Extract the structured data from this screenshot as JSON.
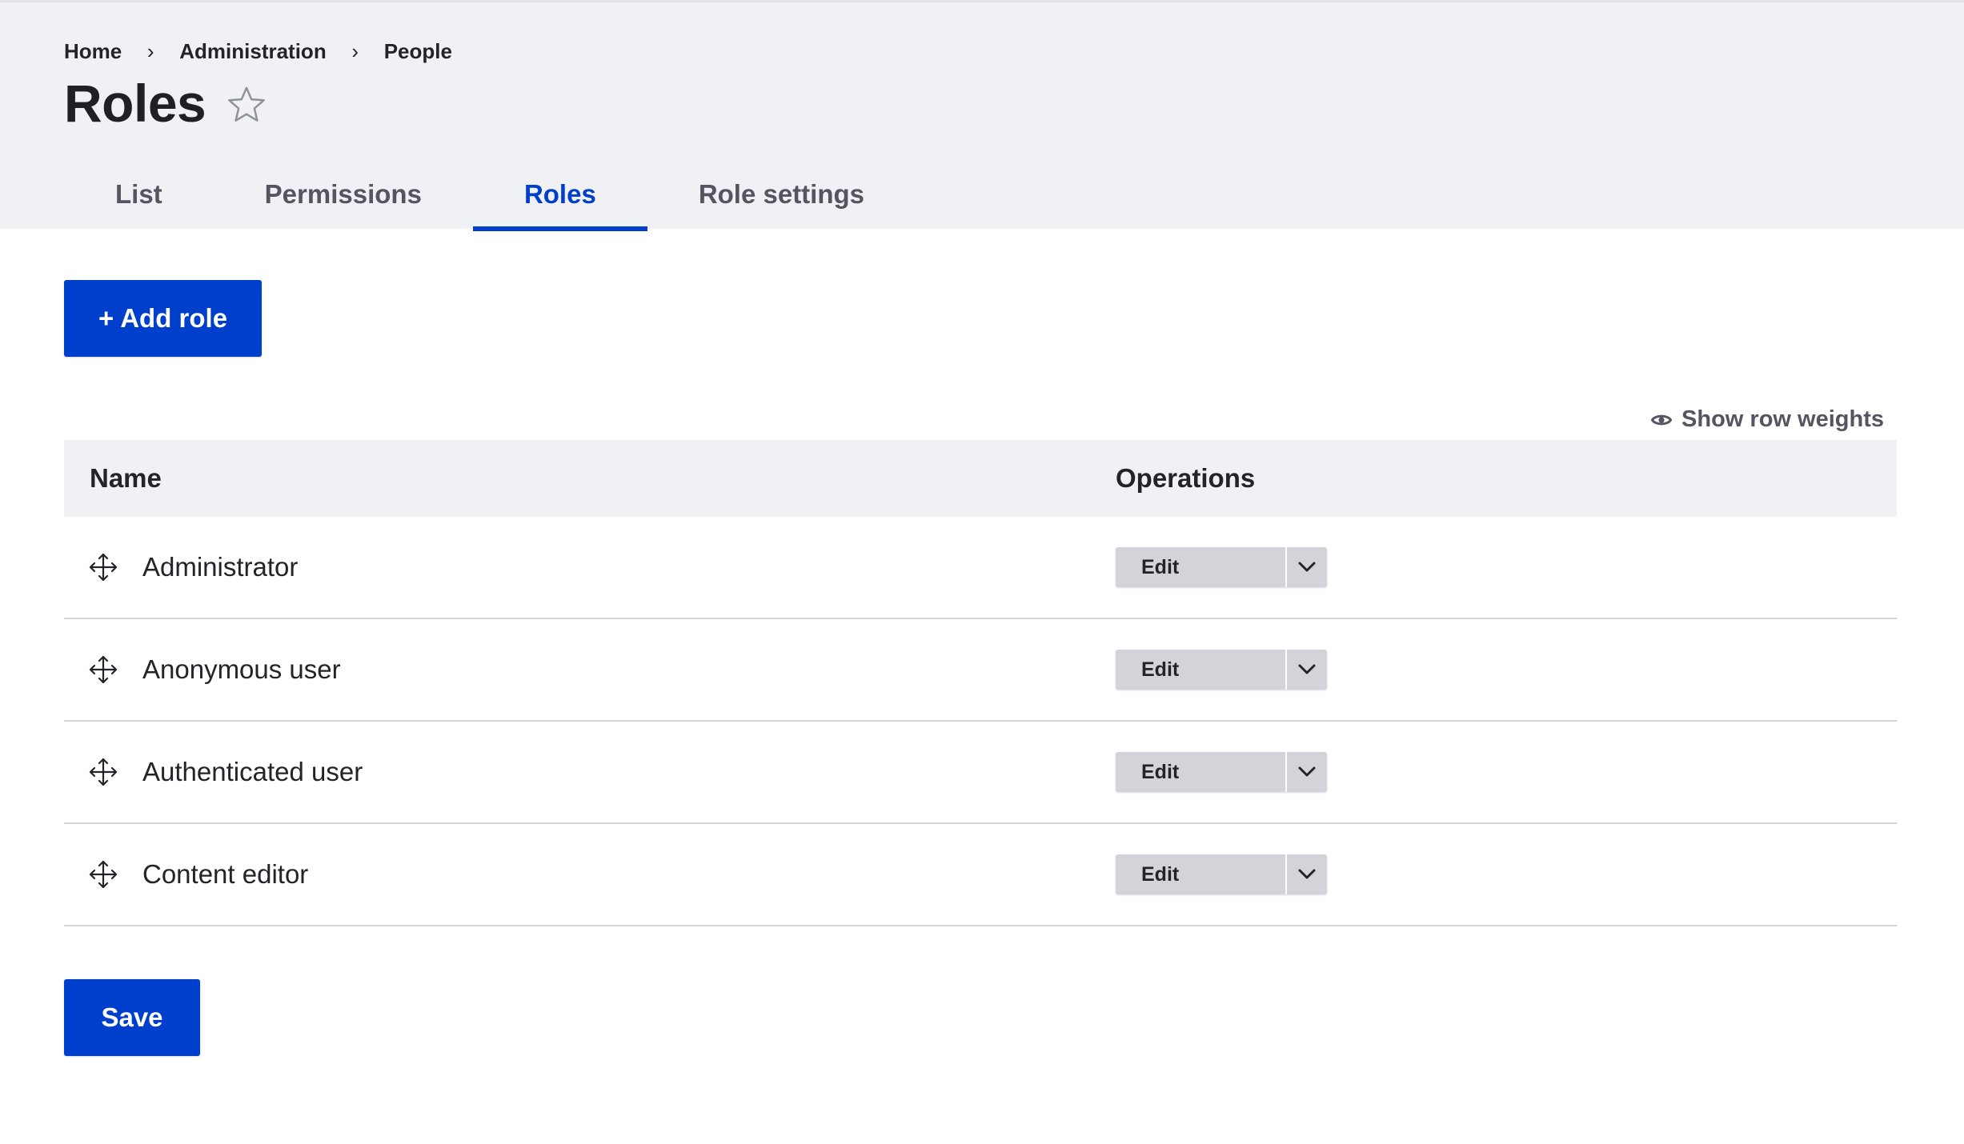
{
  "breadcrumb": {
    "items": [
      "Home",
      "Administration",
      "People"
    ],
    "separator": "›"
  },
  "page": {
    "title": "Roles",
    "favorite_icon": "star-outline-icon"
  },
  "tabs": [
    {
      "label": "List",
      "active": false
    },
    {
      "label": "Permissions",
      "active": false
    },
    {
      "label": "Roles",
      "active": true
    },
    {
      "label": "Role settings",
      "active": false
    }
  ],
  "actions": {
    "add_role_plus": "+",
    "add_role_label": "Add role",
    "save_label": "Save"
  },
  "table": {
    "show_row_weights_label": "Show row weights",
    "columns": {
      "name": "Name",
      "operations": "Operations"
    },
    "rows": [
      {
        "name": "Administrator",
        "operation": "Edit"
      },
      {
        "name": "Anonymous user",
        "operation": "Edit"
      },
      {
        "name": "Authenticated user",
        "operation": "Edit"
      },
      {
        "name": "Content editor",
        "operation": "Edit"
      }
    ]
  },
  "colors": {
    "accent": "#003ecc",
    "header_bg": "#f0f1f5",
    "dropbutton_bg": "#d3d4d9",
    "text": "#232429"
  }
}
